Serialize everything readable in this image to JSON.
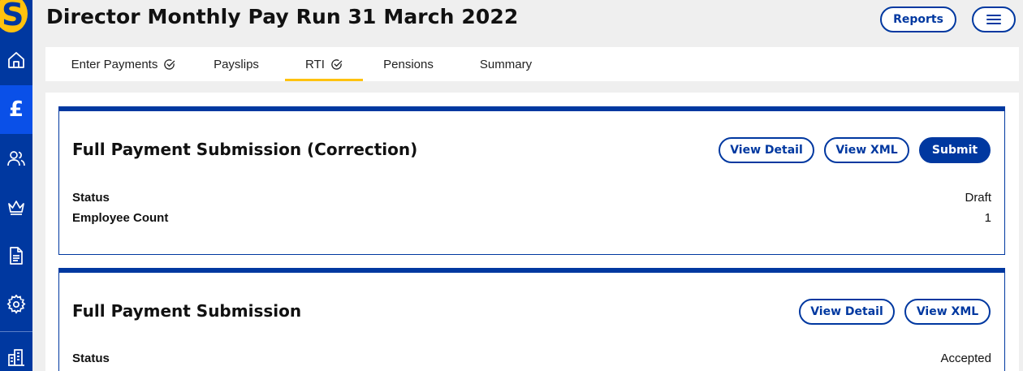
{
  "header": {
    "title": "Director Monthly Pay Run 31 March 2022",
    "reports_label": "Reports"
  },
  "tabs": [
    {
      "label": "Enter Payments",
      "checked": true
    },
    {
      "label": "Payslips",
      "checked": false
    },
    {
      "label": "RTI",
      "checked": true,
      "active": true
    },
    {
      "label": "Pensions",
      "checked": false
    },
    {
      "label": "Summary",
      "checked": false
    }
  ],
  "sidebar": {
    "logo_letter": "S",
    "items": [
      {
        "icon": "home-icon"
      },
      {
        "icon": "pound-icon",
        "glyph": "£",
        "active": true
      },
      {
        "icon": "people-icon"
      },
      {
        "icon": "crown-icon"
      },
      {
        "icon": "document-icon"
      },
      {
        "icon": "gear-icon"
      },
      {
        "icon": "building-icon"
      }
    ]
  },
  "cards": [
    {
      "title": "Full Payment Submission (Correction)",
      "buttons": {
        "view_detail": "View Detail",
        "view_xml": "View XML",
        "submit": "Submit"
      },
      "rows": [
        {
          "label": "Status",
          "value": "Draft"
        },
        {
          "label": "Employee Count",
          "value": "1"
        }
      ]
    },
    {
      "title": "Full Payment Submission",
      "buttons": {
        "view_detail": "View Detail",
        "view_xml": "View XML"
      },
      "rows": [
        {
          "label": "Status",
          "value": "Accepted"
        }
      ]
    }
  ],
  "colors": {
    "brand_blue": "#0038a0",
    "active_nav": "#0a50e8",
    "accent_yellow": "#ffc20e"
  }
}
